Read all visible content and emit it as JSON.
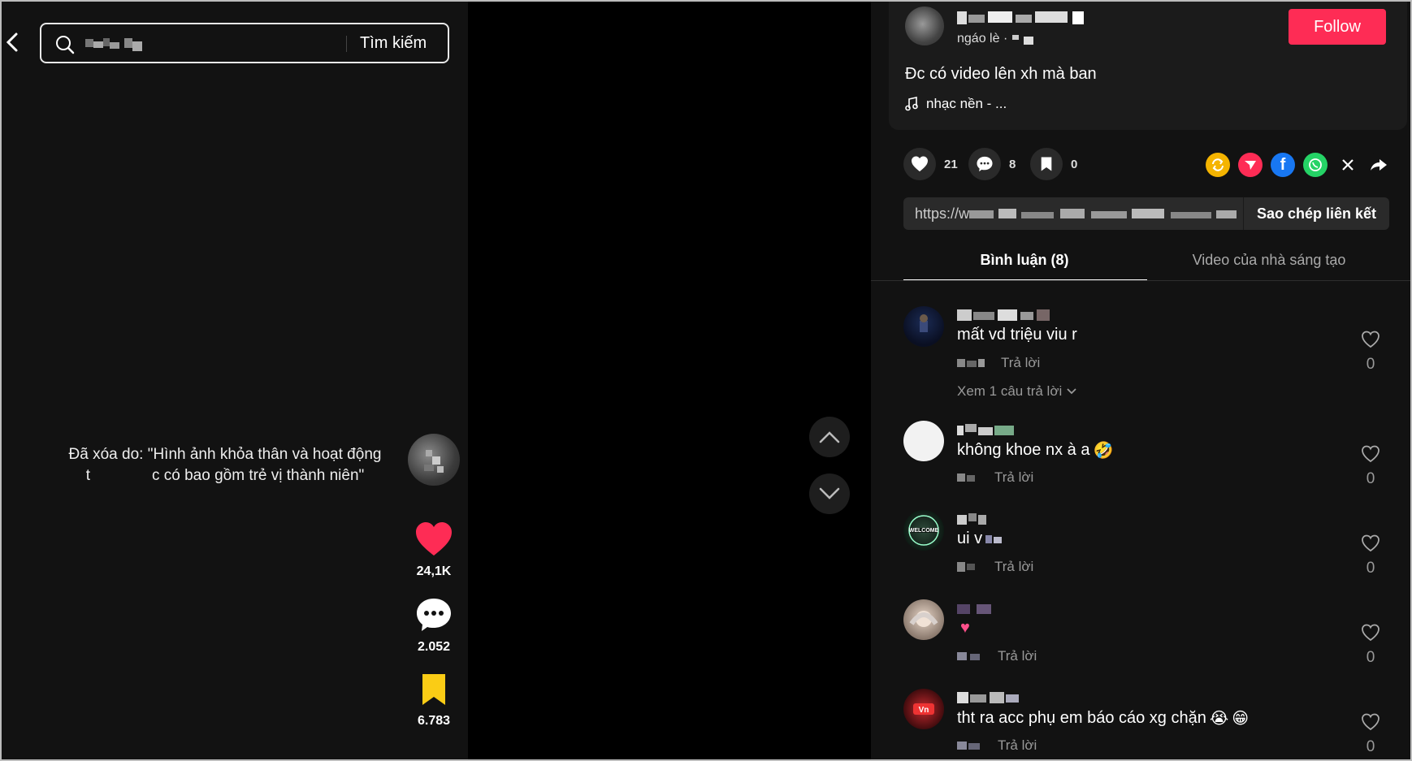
{
  "search": {
    "button_label": "Tìm kiếm"
  },
  "video": {
    "removed_notice": "Đã xóa do: \"Hình ảnh khỏa thân và hoạt động t    c có bao gồm trẻ vị thành niên\"",
    "likes": "24,1K",
    "comments": "2.052",
    "saves": "6.783"
  },
  "author": {
    "nickname": "ngáo lè ·",
    "follow_label": "Follow",
    "caption": "Đc có video lên xh mà ban",
    "music": "nhạc nền - ..."
  },
  "stats": {
    "likes": "21",
    "comments": "8",
    "saves": "0"
  },
  "link": {
    "url": "https://w",
    "copy_label": "Sao chép liên kết"
  },
  "tabs": [
    {
      "label": "Bình luận (8)"
    },
    {
      "label": "Video của nhà sáng tạo"
    }
  ],
  "comments": [
    {
      "text": "mất vd triệu viu r",
      "reply": "Trả lời",
      "likes": "0",
      "view_replies": "Xem 1 câu trả lời"
    },
    {
      "text": "không khoe nx à a",
      "reply": "Trả lời",
      "likes": "0"
    },
    {
      "text": "ui v",
      "reply": "Trả lời",
      "likes": "0"
    },
    {
      "text": "",
      "reply": "Trả lời",
      "likes": "0"
    },
    {
      "text": "tht ra acc phụ em báo cáo xg chặn",
      "reply": "Trả lời",
      "likes": "0"
    }
  ],
  "colors": {
    "accent": "#fe2c55",
    "save_yellow": "#facc15",
    "background": "#121212"
  }
}
